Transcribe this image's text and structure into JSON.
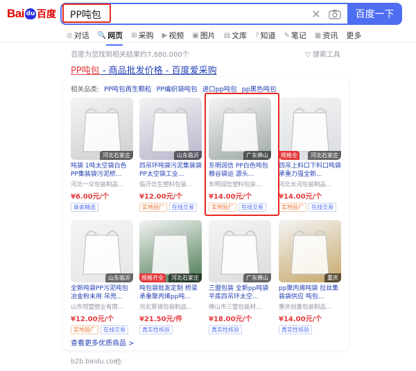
{
  "logo": {
    "bai": "Bai",
    "paw": "du",
    "du": "百度"
  },
  "search": {
    "query": "PP吨包",
    "button_label": "百度一下"
  },
  "tabs": [
    {
      "icon": "ai-icon",
      "label": "对话"
    },
    {
      "icon": "search-icon",
      "label": "网页"
    },
    {
      "icon": "cart-icon",
      "label": "采购"
    },
    {
      "icon": "video-icon",
      "label": "视频"
    },
    {
      "icon": "image-icon",
      "label": "图片"
    },
    {
      "icon": "doc-icon",
      "label": "文库"
    },
    {
      "icon": "question-icon",
      "label": "知道"
    },
    {
      "icon": "note-icon",
      "label": "笔记"
    },
    {
      "icon": "news-icon",
      "label": "资讯"
    },
    {
      "icon": "",
      "label": "更多"
    }
  ],
  "result_count": "百度为您找到相关结果约7,880,000个",
  "tools": "搜索工具",
  "result": {
    "title_hl": "PP吨包",
    "title_rest": " - 商品批发价格 - 百度爱采购"
  },
  "related": {
    "label": "相关品类:",
    "items": [
      "PP吨包再生颗粒",
      "PP编织袋吨包",
      "进口pp吨包",
      "pp黑色吨包"
    ]
  },
  "products": [
    {
      "title": "吨袋 1吨太空袋白色PP集装袋污泥桥...",
      "seller": "河北一众包装制品...",
      "price": "¥6.00元/个",
      "badges": [
        "商家精选"
      ],
      "loc": "河北石家庄",
      "tag": "",
      "img": "#cfcfcf"
    },
    {
      "title": "四吊环吨袋污泥集装袋PP太空袋工业...",
      "seller": "临沂信生塑料包装...",
      "price": "¥12.00元/个",
      "badges": [
        "实地验厂",
        "在线交易"
      ],
      "loc": "山东临沂",
      "tag": "",
      "img": "#b8b4cc"
    },
    {
      "title": "东明润信 PP白色吨包粮谷袋运 源头...",
      "seller": "东明润信塑料包装...",
      "price": "¥14.00元/个",
      "badges": [
        "实地验厂",
        "在线交易"
      ],
      "loc": "广东佛山",
      "tag": "",
      "img": "#9faaa6"
    },
    {
      "title": "四吊上料口下料口吨袋 承重力强全新...",
      "seller": "河北长河包装制品...",
      "price": "¥14.00元/个",
      "badges": [
        "实地验厂",
        "在线交易"
      ],
      "loc": "河北石家庄",
      "tag": "规格全",
      "img": "#d9dce2"
    },
    {
      "title": "全新吨袋PP污泥吨包冶金粉末用 吊兜...",
      "seller": "山东恒盟塑业有限...",
      "price": "¥12.00元/个",
      "badges": [
        "实地验厂",
        "在线交易"
      ],
      "loc": "山东临沂",
      "tag": "",
      "img": "#e6e6e6"
    },
    {
      "title": "吨包袋批发定制 桥梁承重聚丙烯pp吨...",
      "seller": "河北营诚包装制品...",
      "price": "¥21.50元/件",
      "badges": [
        "真实性核验"
      ],
      "loc": "河北石家庄",
      "tag": "规格齐全",
      "img": "#4a7a52"
    },
    {
      "title": "三盟包装 全新pp吨袋平底四吊环太空...",
      "seller": "佛山市三盟包装材...",
      "price": "¥18.00元/个",
      "badges": [
        "真实性核验"
      ],
      "loc": "广东佛山",
      "tag": "",
      "img": "#dcdcdc"
    },
    {
      "title": "pp聚丙烯吨袋 拉丝集装袋供应 吨包...",
      "seller": "重庆创嘉包装制品...",
      "price": "¥14.00元/个",
      "badges": [
        "真实性核验"
      ],
      "loc": "重庆",
      "tag": "",
      "img": "#c7a86a"
    }
  ],
  "more_link": "查看更多优质商品 >",
  "footer_url": "b2b.baidu.com",
  "colors": {
    "accent": "#4e6ef2",
    "highlight": "#e4393c",
    "outline": "#e8261f"
  }
}
